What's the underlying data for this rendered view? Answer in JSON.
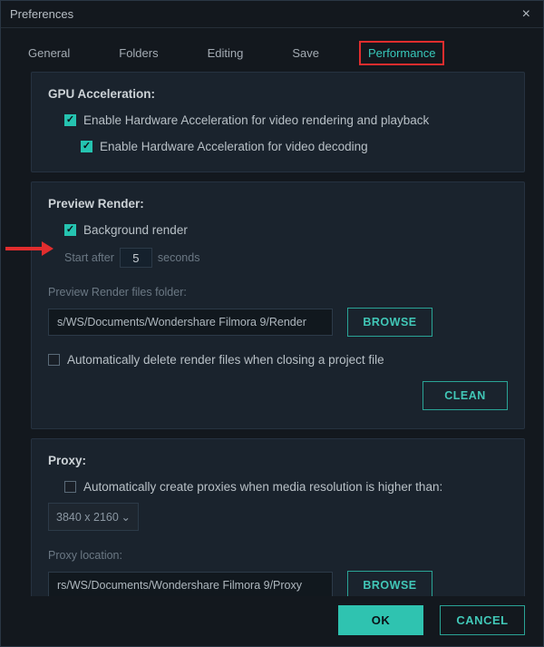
{
  "window": {
    "title": "Preferences"
  },
  "tabs": {
    "general": "General",
    "folders": "Folders",
    "editing": "Editing",
    "save": "Save",
    "performance": "Performance"
  },
  "gpu": {
    "title": "GPU Acceleration:",
    "hw_render": "Enable Hardware Acceleration for video rendering and playback",
    "hw_decode": "Enable Hardware Acceleration for video decoding"
  },
  "preview": {
    "title": "Preview Render:",
    "bg_render": "Background render",
    "start_after": "Start after",
    "start_value": "5",
    "seconds": "seconds",
    "folder_label": "Preview Render files folder:",
    "folder_value": "s/WS/Documents/Wondershare Filmora 9/Render",
    "browse": "BROWSE",
    "auto_delete": "Automatically delete render files when closing a project file",
    "clean": "CLEAN"
  },
  "proxy": {
    "title": "Proxy:",
    "auto_create": "Automatically create proxies when media resolution is higher than:",
    "resolution": "3840 x 2160",
    "location_label": "Proxy location:",
    "location_value": "rs/WS/Documents/Wondershare Filmora 9/Proxy",
    "browse": "BROWSE"
  },
  "footer": {
    "ok": "OK",
    "cancel": "CANCEL"
  }
}
